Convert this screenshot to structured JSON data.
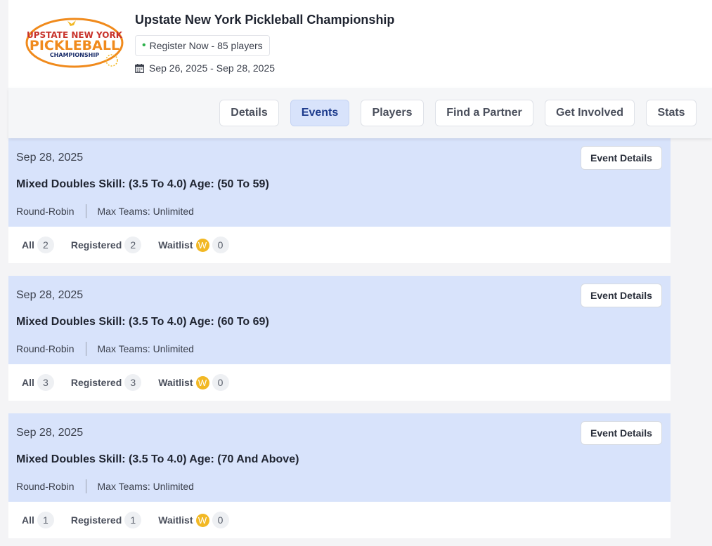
{
  "header": {
    "logo_text": {
      "line1": "UPSTATE NEW YORK",
      "line2": "PICKLEBALL",
      "line3": "CHAMPIONSHIP"
    },
    "title": "Upstate New York Pickleball Championship",
    "register_label": "Register Now - 85 players",
    "dates": "Sep 26, 2025 - Sep 28, 2025"
  },
  "nav": {
    "tabs": [
      {
        "label": "Details",
        "active": false
      },
      {
        "label": "Events",
        "active": true
      },
      {
        "label": "Players",
        "active": false
      },
      {
        "label": "Find a Partner",
        "active": false
      },
      {
        "label": "Get Involved",
        "active": false
      },
      {
        "label": "Stats",
        "active": false
      }
    ]
  },
  "events": [
    {
      "date": "Sep 28, 2025",
      "details_label": "Event Details",
      "name": "Mixed Doubles Skill: (3.5 To 4.0) Age: (50 To 59)",
      "format": "Round-Robin",
      "max_teams": "Max Teams: Unlimited",
      "all_label": "All",
      "all_count": "2",
      "registered_label": "Registered",
      "registered_count": "2",
      "waitlist_label": "Waitlist",
      "waitlist_badge": "W",
      "waitlist_count": "0"
    },
    {
      "date": "Sep 28, 2025",
      "details_label": "Event Details",
      "name": "Mixed Doubles Skill: (3.5 To 4.0) Age: (60 To 69)",
      "format": "Round-Robin",
      "max_teams": "Max Teams: Unlimited",
      "all_label": "All",
      "all_count": "3",
      "registered_label": "Registered",
      "registered_count": "3",
      "waitlist_label": "Waitlist",
      "waitlist_badge": "W",
      "waitlist_count": "0"
    },
    {
      "date": "Sep 28, 2025",
      "details_label": "Event Details",
      "name": "Mixed Doubles Skill: (3.5 To 4.0) Age: (70 And Above)",
      "format": "Round-Robin",
      "max_teams": "Max Teams: Unlimited",
      "all_label": "All",
      "all_count": "1",
      "registered_label": "Registered",
      "registered_count": "1",
      "waitlist_label": "Waitlist",
      "waitlist_badge": "W",
      "waitlist_count": "0"
    }
  ],
  "colors": {
    "accent": "#d8e3fb",
    "active_text": "#1d3b8c",
    "status_green": "#2bb04a",
    "waitlist_badge": "#f2b824",
    "logo_orange": "#f08a1c",
    "logo_red": "#c8322b",
    "logo_navy": "#1c2f6b"
  }
}
